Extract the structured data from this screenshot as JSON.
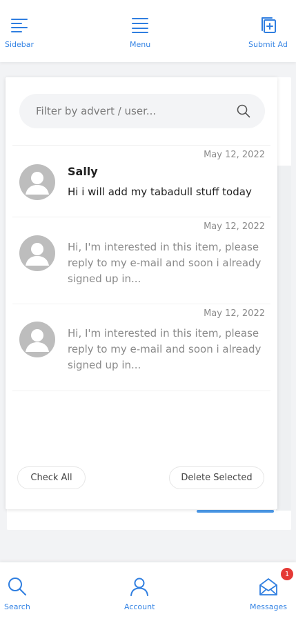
{
  "toolbar": {
    "sidebar_label": "Sidebar",
    "menu_label": "Menu",
    "submit_label": "Submit Ad"
  },
  "search": {
    "placeholder": "Filter by advert / user..."
  },
  "messages": [
    {
      "date": "May 12, 2022",
      "sender": "Sally",
      "text": "Hi i will add my tabadull stuff today",
      "read": true
    },
    {
      "date": "May 12, 2022",
      "sender": "",
      "text": "Hi, I'm interested in this item, please reply to my e-mail and soon i already signed up in...",
      "read": false
    },
    {
      "date": "May 12, 2022",
      "sender": "",
      "text": "Hi, I'm interested in this item, please reply to my e-mail and soon i already signed up in...",
      "read": false
    }
  ],
  "actions": {
    "check_all": "Check All",
    "delete_selected": "Delete Selected"
  },
  "bottom_nav": {
    "search_label": "Search",
    "account_label": "Account",
    "messages_label": "Messages",
    "messages_badge": "1"
  },
  "colors": {
    "accent": "#3584e4",
    "badge": "#e53935",
    "avatar": "#bdbdbd"
  }
}
